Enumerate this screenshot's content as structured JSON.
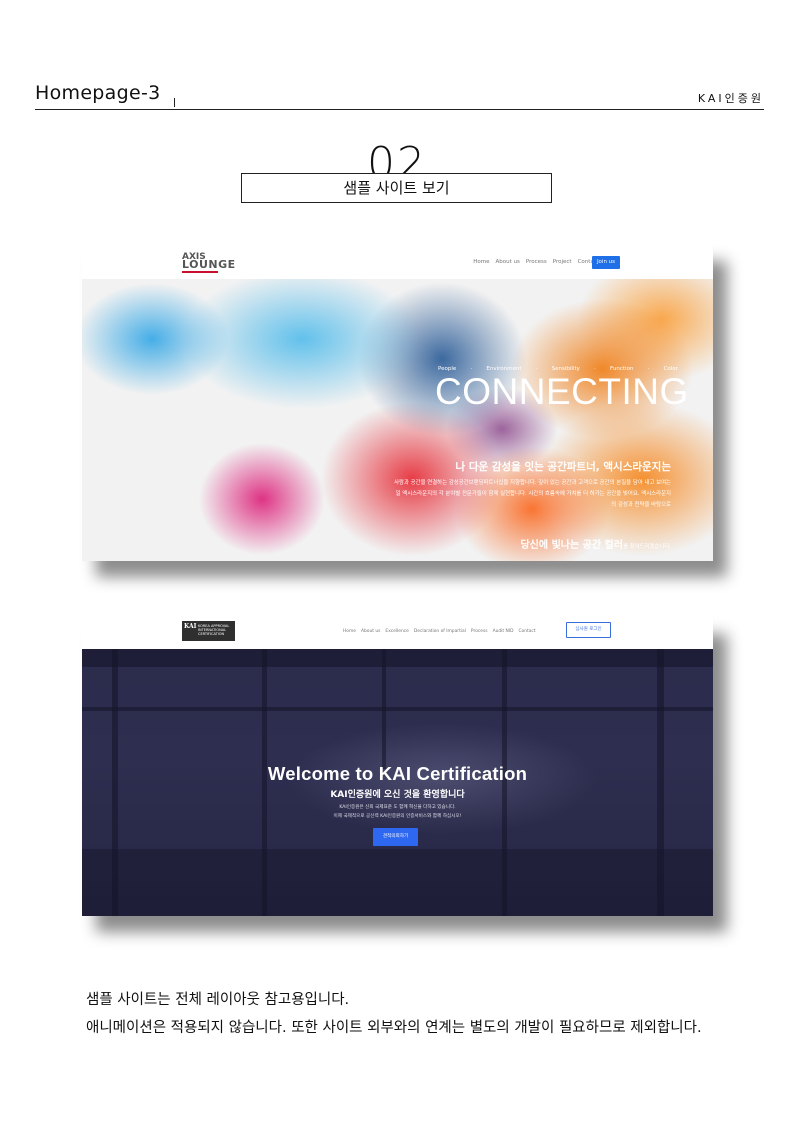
{
  "header": {
    "title": "Homepage-3",
    "brand": "KAI인증원"
  },
  "section": {
    "number": "02",
    "heading": "샘플 사이트 보기"
  },
  "sample1": {
    "logo_line1": "AXIS",
    "logo_line2": "LOUNGE",
    "nav": [
      "Home",
      "About us",
      "Process",
      "Project",
      "Contact"
    ],
    "cta": "Join us",
    "tagline": [
      "People",
      "·",
      "Environment",
      "·",
      "Sensibility",
      "·",
      "Function",
      "·",
      "Color"
    ],
    "headline": "CONNECTING",
    "slogan": "나 다운 감성을 잇는 공간파트너, 액시스라운지는",
    "paragraph": "사람과 공간을 연결하는 감성공간브랜딩파트너십을 지향합니다. 깊이 있는 공간과 고객으로 공간의 본질을 담아 내고 보여는 일 액시스라운지의 각 분야별 전문가들이 함께 실현합니다. 시간의 흐름속에 가치를 더 하가는 공간을 빚어요. 액시스라운지의 감성과 전략을 바탕으로",
    "closing_bold": "당신에 빛나는 공간 컬러",
    "closing_rest": "를 찾아드리겠습니다."
  },
  "sample2": {
    "logo_mark": "KAI",
    "logo_text": "KOREA APPROVAL INTERNATIONAL CERTIFICATION",
    "nav": [
      "Home",
      "About us",
      "Excellence",
      "Declaration of Impartial",
      "Process",
      "Audit NID",
      "Contact"
    ],
    "cta": "심사원 로그인",
    "title": "Welcome to KAI Certification",
    "subtitle": "KAI인증원에 오신 것을 환영합니다",
    "desc1": "KAI인증원은 신뢰 국제표준 도 함께 혁신을 다하고 있습니다.",
    "desc2": "이제 국제적으로 공신력 KAI인증원의 인증서비스와 함께 하십시오!",
    "button": "견적의뢰하기"
  },
  "caption": {
    "line1": "샘플 사이트는 전체 레이아웃 참고용입니다.",
    "line2": "애니메이션은 적용되지 않습니다. 또한 사이트 외부와의 연계는 별도의 개발이 필요하므로 제외합니다."
  }
}
